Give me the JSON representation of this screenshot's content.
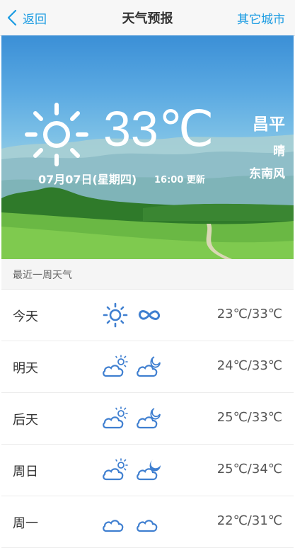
{
  "nav": {
    "back_label": "返回",
    "title": "天气预报",
    "other_cities_label": "其它城市"
  },
  "current": {
    "temperature": "33℃",
    "date": "07月07日(星期四)",
    "update_time": "16:00 更新",
    "city": "昌平",
    "condition": "晴",
    "wind": "东南风",
    "icon": "sun-icon"
  },
  "forecast": {
    "header": "最近一周天气",
    "days": [
      {
        "day": "今天",
        "icon_day": "sun-icon",
        "icon_night": "infinity-icon",
        "range": "23℃/33℃"
      },
      {
        "day": "明天",
        "icon_day": "partly-cloudy-sun-icon",
        "icon_night": "cloud-moon-icon",
        "range": "24℃/33℃"
      },
      {
        "day": "后天",
        "icon_day": "partly-cloudy-sun-icon",
        "icon_night": "cloud-moon-icon",
        "range": "25℃/33℃"
      },
      {
        "day": "周日",
        "icon_day": "partly-cloudy-sun-icon",
        "icon_night": "cloud-moon-filled-icon",
        "range": "25℃/34℃"
      },
      {
        "day": "周一",
        "icon_day": "cloud-icon",
        "icon_night": "cloud-icon",
        "range": "22℃/31℃"
      }
    ]
  },
  "colors": {
    "accent": "#1a9be2",
    "icon_blue": "#3f7fd0"
  }
}
